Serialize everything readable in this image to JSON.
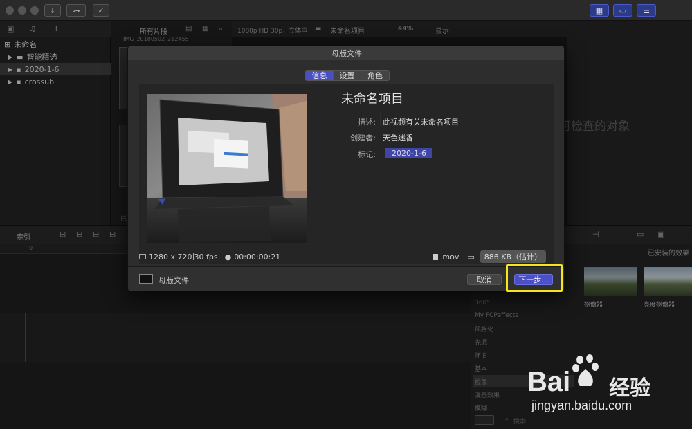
{
  "modal": {
    "title": "母版文件",
    "tabs": [
      {
        "label": "信息",
        "selected": true
      },
      {
        "label": "设置",
        "selected": false
      },
      {
        "label": "角色",
        "selected": false
      }
    ],
    "project_title": "未命名项目",
    "fields": [
      {
        "label": "描述:",
        "value": "此视频有关未命名项目"
      },
      {
        "label": "创建者:",
        "value": "天色迷香"
      },
      {
        "label": "标记:",
        "value": "2020-1-6"
      }
    ],
    "resolution": "1280 x 720",
    "fps": "30 fps",
    "duration": "00:00:00:21",
    "format": ".mov",
    "size": "886 KB（估计）",
    "footer_label": "母版文件",
    "cancel_label": "取消",
    "next_label": "下一步..."
  },
  "library": {
    "items": [
      {
        "label": "未命名"
      },
      {
        "label": "智能精选"
      },
      {
        "label": "2020-1-6"
      },
      {
        "label": "crossub"
      }
    ]
  },
  "browser": {
    "filter_label": "所有片段",
    "clip_name": "IMG_20180502_212455",
    "item_label": "已"
  },
  "viewer": {
    "format_label": "1080p HD 30p，立体声",
    "project_label": "未命名项目",
    "zoom": "44%",
    "display_label": "显示"
  },
  "inspector": {
    "empty_text": "可检查的对象"
  },
  "timeline": {
    "index_label": "索引",
    "ruler_start": "0"
  },
  "effects": {
    "header": "已安装的效果",
    "categories": [
      "360°",
      "My FCPeffects",
      "风格化",
      "光源",
      "怀旧",
      "基本",
      "拉像",
      "漫画效果",
      "模糊"
    ],
    "thumbs": [
      {
        "label": "抠像器"
      },
      {
        "label": "亮度抠像器"
      }
    ],
    "search_placeholder": "搜索"
  },
  "watermark": {
    "brand": "Bai",
    "brand_suffix": "经验",
    "url": "jingyan.baidu.com"
  },
  "colors": {
    "accent": "#4b4fc8",
    "highlight": "#f4e51c"
  }
}
